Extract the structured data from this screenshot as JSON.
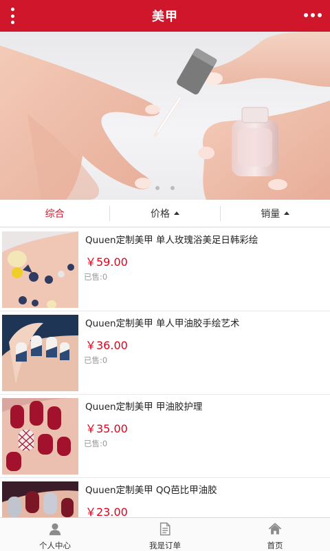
{
  "header": {
    "title": "美甲"
  },
  "sort_tabs": [
    {
      "label": "综合"
    },
    {
      "label": "价格"
    },
    {
      "label": "销量"
    }
  ],
  "products": [
    {
      "name": "Quuen定制美甲 单人玫瑰浴美足日韩彩绘",
      "price": "￥59.00",
      "sold": "已售:0"
    },
    {
      "name": "Quuen定制美甲 单人甲油胶手绘艺术",
      "price": "￥36.00",
      "sold": "已售:0"
    },
    {
      "name": "Quuen定制美甲 甲油胶护理",
      "price": "￥35.00",
      "sold": "已售:0"
    },
    {
      "name": "Quuen定制美甲 QQ芭比甲油胶",
      "price": "￥23.00"
    }
  ],
  "tabbar": [
    {
      "label": "个人中心",
      "icon": "user-icon"
    },
    {
      "label": "我是订单",
      "icon": "document-icon"
    },
    {
      "label": "首页",
      "icon": "home-icon"
    }
  ],
  "colors": {
    "brand": "#d0162b",
    "price": "#e4001b"
  }
}
